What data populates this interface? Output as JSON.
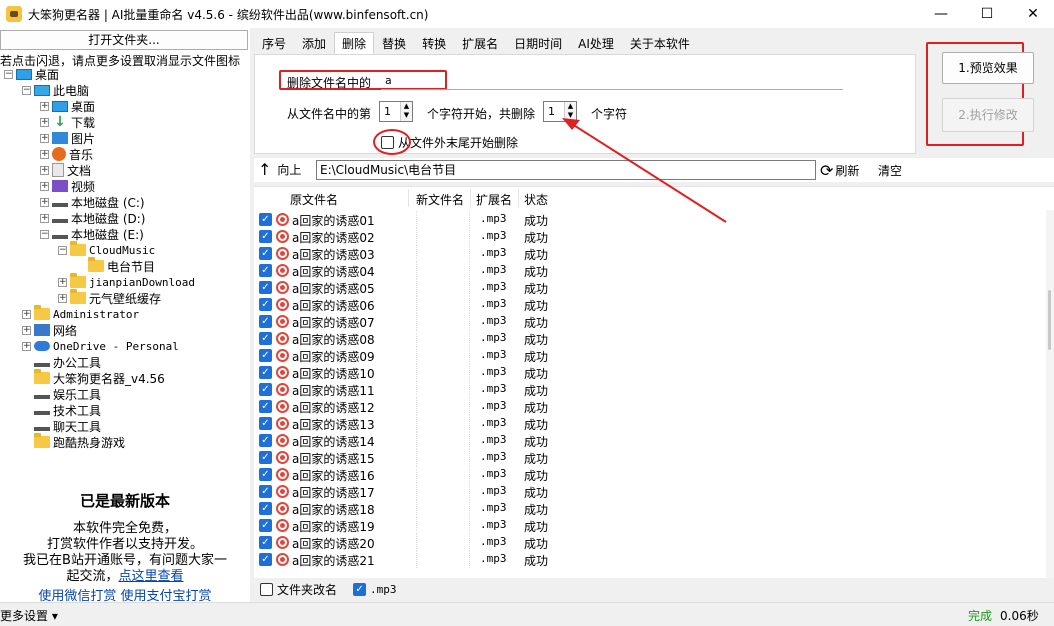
{
  "window": {
    "title": "大笨狗更名器 | AI批量重命名 v4.5.6 - 缤纷软件出品(www.binfensoft.cn)",
    "min_glyph": "—",
    "max_glyph": "☐",
    "close_glyph": "✕"
  },
  "left": {
    "open_folder": "打开文件夹...",
    "hint": "若点击闪退，请点更多设置取消显示文件图标",
    "tree": [
      {
        "label": "桌面",
        "icon": "desktop-icon",
        "indent": 0,
        "expander": "−"
      },
      {
        "label": "此电脑",
        "icon": "computer-icon",
        "indent": 1,
        "expander": "−"
      },
      {
        "label": "桌面",
        "icon": "desktop-icon",
        "indent": 2,
        "expander": "+"
      },
      {
        "label": "下载",
        "icon": "download-icon",
        "indent": 2,
        "expander": "+"
      },
      {
        "label": "图片",
        "icon": "pictures-icon",
        "indent": 2,
        "expander": "+"
      },
      {
        "label": "音乐",
        "icon": "music-icon",
        "indent": 2,
        "expander": "+"
      },
      {
        "label": "文档",
        "icon": "documents-icon",
        "indent": 2,
        "expander": "+"
      },
      {
        "label": "视频",
        "icon": "videos-icon",
        "indent": 2,
        "expander": "+"
      },
      {
        "label": "本地磁盘 (C:)",
        "icon": "drive-icon",
        "indent": 2,
        "expander": "+"
      },
      {
        "label": "本地磁盘 (D:)",
        "icon": "drive-icon",
        "indent": 2,
        "expander": "+"
      },
      {
        "label": "本地磁盘 (E:)",
        "icon": "drive-icon",
        "indent": 2,
        "expander": "−"
      },
      {
        "label": "CloudMusic",
        "icon": "folder-icon",
        "indent": 3,
        "expander": "−"
      },
      {
        "label": "电台节目",
        "icon": "folder-icon",
        "indent": 4,
        "expander": ""
      },
      {
        "label": "jianpianDownload",
        "icon": "folder-icon",
        "indent": 3,
        "expander": "+"
      },
      {
        "label": "元气壁纸缓存",
        "icon": "folder-icon",
        "indent": 3,
        "expander": "+"
      },
      {
        "label": "Administrator",
        "icon": "folder-icon",
        "indent": 1,
        "expander": "+"
      },
      {
        "label": "网络",
        "icon": "network-icon",
        "indent": 1,
        "expander": "+"
      },
      {
        "label": "OneDrive - Personal",
        "icon": "cloud-icon",
        "indent": 1,
        "expander": "+"
      },
      {
        "label": "办公工具",
        "icon": "drive-icon",
        "indent": 1,
        "expander": ""
      },
      {
        "label": "大笨狗更名器_v4.56",
        "icon": "folder-icon",
        "indent": 1,
        "expander": ""
      },
      {
        "label": "娱乐工具",
        "icon": "drive-icon",
        "indent": 1,
        "expander": ""
      },
      {
        "label": "技术工具",
        "icon": "drive-icon",
        "indent": 1,
        "expander": ""
      },
      {
        "label": "聊天工具",
        "icon": "drive-icon",
        "indent": 1,
        "expander": ""
      },
      {
        "label": "跑酷热身游戏",
        "icon": "folder-icon",
        "indent": 1,
        "expander": ""
      }
    ],
    "promo": {
      "title": "已是最新版本",
      "line1": "本软件完全免费，",
      "line2": "打赏软件作者以支持开发。",
      "line3": "我已在B站开通账号，有问题大家一",
      "line4_prefix": "起交流，",
      "line4_link": "点这里查看",
      "links": "使用微信打赏    使用支付宝打赏"
    }
  },
  "tabs": [
    "序号",
    "添加",
    "删除",
    "替换",
    "转换",
    "扩展名",
    "日期时间",
    "AI处理",
    "关于本软件"
  ],
  "active_tab": "删除",
  "delete_panel": {
    "delete_label": "删除文件名中的",
    "delete_value": "a",
    "from_label": "从文件名中的第",
    "start_value": "1",
    "chars_label_1": "个字符开始，共删除",
    "count_value": "1",
    "chars_label_2": "个字符",
    "from_end_label": "从文件外末尾开始删除",
    "from_end_checked": false
  },
  "actions": {
    "preview": "1.预览效果",
    "execute": "2.执行修改",
    "execute_enabled": false
  },
  "pathbar": {
    "up": "向上",
    "path": "E:\\CloudMusic\\电台节目",
    "refresh": "刷新",
    "clear": "清空"
  },
  "filelist": {
    "columns": [
      "原文件名",
      "新文件名",
      "扩展名",
      "状态"
    ],
    "rows": [
      {
        "name": "a回家的诱惑01",
        "ext": ".mp3",
        "status": "成功"
      },
      {
        "name": "a回家的诱惑02",
        "ext": ".mp3",
        "status": "成功"
      },
      {
        "name": "a回家的诱惑03",
        "ext": ".mp3",
        "status": "成功"
      },
      {
        "name": "a回家的诱惑04",
        "ext": ".mp3",
        "status": "成功"
      },
      {
        "name": "a回家的诱惑05",
        "ext": ".mp3",
        "status": "成功"
      },
      {
        "name": "a回家的诱惑06",
        "ext": ".mp3",
        "status": "成功"
      },
      {
        "name": "a回家的诱惑07",
        "ext": ".mp3",
        "status": "成功"
      },
      {
        "name": "a回家的诱惑08",
        "ext": ".mp3",
        "status": "成功"
      },
      {
        "name": "a回家的诱惑09",
        "ext": ".mp3",
        "status": "成功"
      },
      {
        "name": "a回家的诱惑10",
        "ext": ".mp3",
        "status": "成功"
      },
      {
        "name": "a回家的诱惑11",
        "ext": ".mp3",
        "status": "成功"
      },
      {
        "name": "a回家的诱惑12",
        "ext": ".mp3",
        "status": "成功"
      },
      {
        "name": "a回家的诱惑13",
        "ext": ".mp3",
        "status": "成功"
      },
      {
        "name": "a回家的诱惑14",
        "ext": ".mp3",
        "status": "成功"
      },
      {
        "name": "a回家的诱惑15",
        "ext": ".mp3",
        "status": "成功"
      },
      {
        "name": "a回家的诱惑16",
        "ext": ".mp3",
        "status": "成功"
      },
      {
        "name": "a回家的诱惑17",
        "ext": ".mp3",
        "status": "成功"
      },
      {
        "name": "a回家的诱惑18",
        "ext": ".mp3",
        "status": "成功"
      },
      {
        "name": "a回家的诱惑19",
        "ext": ".mp3",
        "status": "成功"
      },
      {
        "name": "a回家的诱惑20",
        "ext": ".mp3",
        "status": "成功"
      },
      {
        "name": "a回家的诱惑21",
        "ext": ".mp3",
        "status": "成功"
      }
    ]
  },
  "bottom": {
    "folder_rename": "文件夹改名",
    "folder_rename_checked": false,
    "ext_filter": ".mp3",
    "ext_filter_checked": true
  },
  "status": {
    "more_settings": "更多设置 ▾",
    "done": "完成",
    "time": "0.06秒"
  },
  "colors": {
    "annotation_red": "#e02020",
    "checkbox_blue": "#1e6fd6",
    "success_green": "#1a9a1a"
  }
}
